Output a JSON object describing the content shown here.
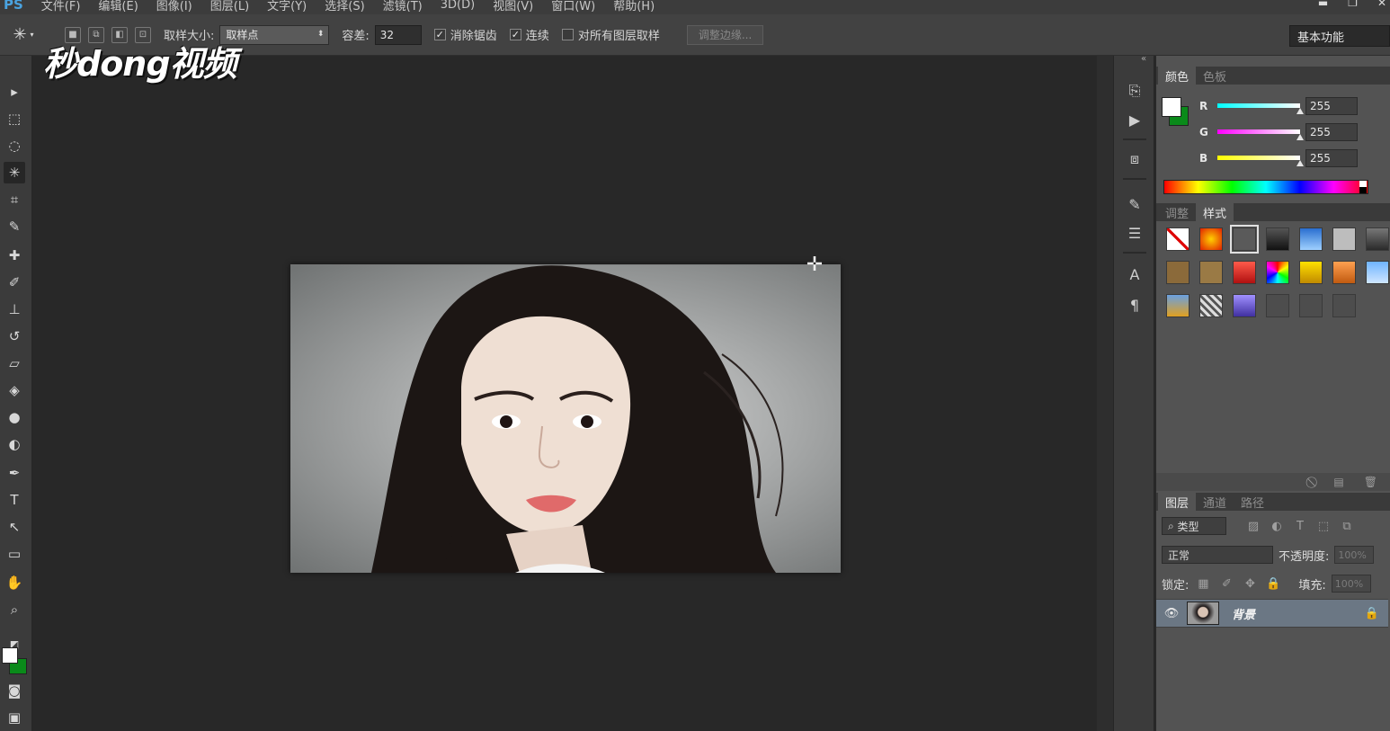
{
  "app": {
    "logo": "PS"
  },
  "menu": [
    "文件(F)",
    "编辑(E)",
    "图像(I)",
    "图层(L)",
    "文字(Y)",
    "选择(S)",
    "滤镜(T)",
    "3D(D)",
    "视图(V)",
    "窗口(W)",
    "帮助(H)"
  ],
  "window_controls": {
    "minimize": "▬",
    "restore": "❐",
    "close": "✕"
  },
  "options": {
    "tool_icon": "magic-wand-icon",
    "sample_size_label": "取样大小:",
    "sample_size_value": "取样点",
    "tolerance_label": "容差:",
    "tolerance_value": "32",
    "anti_alias_label": "消除锯齿",
    "anti_alias_checked": true,
    "contiguous_label": "连续",
    "contiguous_checked": true,
    "all_layers_label": "对所有图层取样",
    "all_layers_checked": false,
    "refine_edge_label": "调整边缘...",
    "workspace": "基本功能"
  },
  "watermark": "秒dong视频",
  "toolbar": {
    "tools": [
      {
        "name": "move-tool",
        "glyph": "▸"
      },
      {
        "name": "marquee-tool",
        "glyph": "⬚"
      },
      {
        "name": "lasso-tool",
        "glyph": "◌"
      },
      {
        "name": "magic-wand-tool",
        "glyph": "✳",
        "active": true
      },
      {
        "name": "crop-tool",
        "glyph": "⌗"
      },
      {
        "name": "eyedropper-tool",
        "glyph": "✎"
      },
      {
        "name": "healing-brush-tool",
        "glyph": "✚"
      },
      {
        "name": "brush-tool",
        "glyph": "✐"
      },
      {
        "name": "clone-stamp-tool",
        "glyph": "⊥"
      },
      {
        "name": "history-brush-tool",
        "glyph": "↺"
      },
      {
        "name": "eraser-tool",
        "glyph": "▱"
      },
      {
        "name": "paint-bucket-tool",
        "glyph": "◈"
      },
      {
        "name": "blur-tool",
        "glyph": "●"
      },
      {
        "name": "dodge-tool",
        "glyph": "◐"
      },
      {
        "name": "pen-tool",
        "glyph": "✒"
      },
      {
        "name": "type-tool",
        "glyph": "T"
      },
      {
        "name": "path-selection-tool",
        "glyph": "↖"
      },
      {
        "name": "rectangle-tool",
        "glyph": "▭"
      },
      {
        "name": "hand-tool",
        "glyph": "✋"
      },
      {
        "name": "zoom-tool",
        "glyph": "⌕"
      }
    ],
    "foreground_color": "#ffffff",
    "background_color": "#0a8a1a"
  },
  "color_panel": {
    "tabs": [
      "颜色",
      "色板"
    ],
    "active_tab": 0,
    "channels": [
      {
        "label": "R",
        "value": "255",
        "color": "#1fd6e6"
      },
      {
        "label": "G",
        "value": "255",
        "color": "#e64ad6"
      },
      {
        "label": "B",
        "value": "255",
        "color": "#f0e020"
      }
    ]
  },
  "styles_panel": {
    "tabs": [
      "调整",
      "样式"
    ],
    "active_tab": 1,
    "swatches": [
      {
        "name": "style-none",
        "bg": "linear-gradient(45deg,#fff 45%,#d00 45%,#d00 55%,#fff 55%)"
      },
      {
        "name": "style-fire",
        "bg": "radial-gradient(circle,#ffd000,#e02000)"
      },
      {
        "name": "style-outline",
        "bg": "#5a5a5a",
        "selected": true
      },
      {
        "name": "style-dark-chrome",
        "bg": "linear-gradient(#555,#111)"
      },
      {
        "name": "style-blue-sky",
        "bg": "linear-gradient(#2a6fd0,#9fd0ff)"
      },
      {
        "name": "style-gray",
        "bg": "#bdbdbd"
      },
      {
        "name": "style-dark-bevel",
        "bg": "linear-gradient(#777,#2a2a2a)"
      },
      {
        "name": "style-bronze",
        "bg": "#8b6a3a"
      },
      {
        "name": "style-wood",
        "bg": "#9a7a45"
      },
      {
        "name": "style-red",
        "bg": "linear-gradient(#ff5a4a,#b01010)"
      },
      {
        "name": "style-rainbow",
        "bg": "conic-gradient(#f00,#ff0,#0f0,#0ff,#00f,#f0f,#f00)"
      },
      {
        "name": "style-gold",
        "bg": "linear-gradient(#ffe000,#c08a00)"
      },
      {
        "name": "style-orange",
        "bg": "linear-gradient(#ffa050,#c05a10)"
      },
      {
        "name": "style-light-blue",
        "bg": "linear-gradient(#6fb4ff,#cfe6ff)"
      },
      {
        "name": "style-sunset",
        "bg": "linear-gradient(#6aa0e0,#e0a020)"
      },
      {
        "name": "style-pattern",
        "bg": "repeating-linear-gradient(45deg,#ddd 0 3px,#555 3px 6px)"
      },
      {
        "name": "style-purple",
        "bg": "linear-gradient(#a090ff,#4030a0)"
      },
      {
        "name": "style-empty-1",
        "bg": "#4d4d4d"
      },
      {
        "name": "style-empty-2",
        "bg": "#4d4d4d"
      },
      {
        "name": "style-empty-3",
        "bg": "#4d4d4d"
      }
    ]
  },
  "layers_panel": {
    "tabs": [
      "图层",
      "通道",
      "路径"
    ],
    "active_tab": 0,
    "filter_label": "类型",
    "blend_mode": "正常",
    "opacity_label": "不透明度:",
    "opacity_value": "100%",
    "lock_label": "锁定:",
    "fill_label": "填充:",
    "fill_value": "100%",
    "layers": [
      {
        "name": "背景",
        "visible": true,
        "locked": true
      }
    ]
  }
}
